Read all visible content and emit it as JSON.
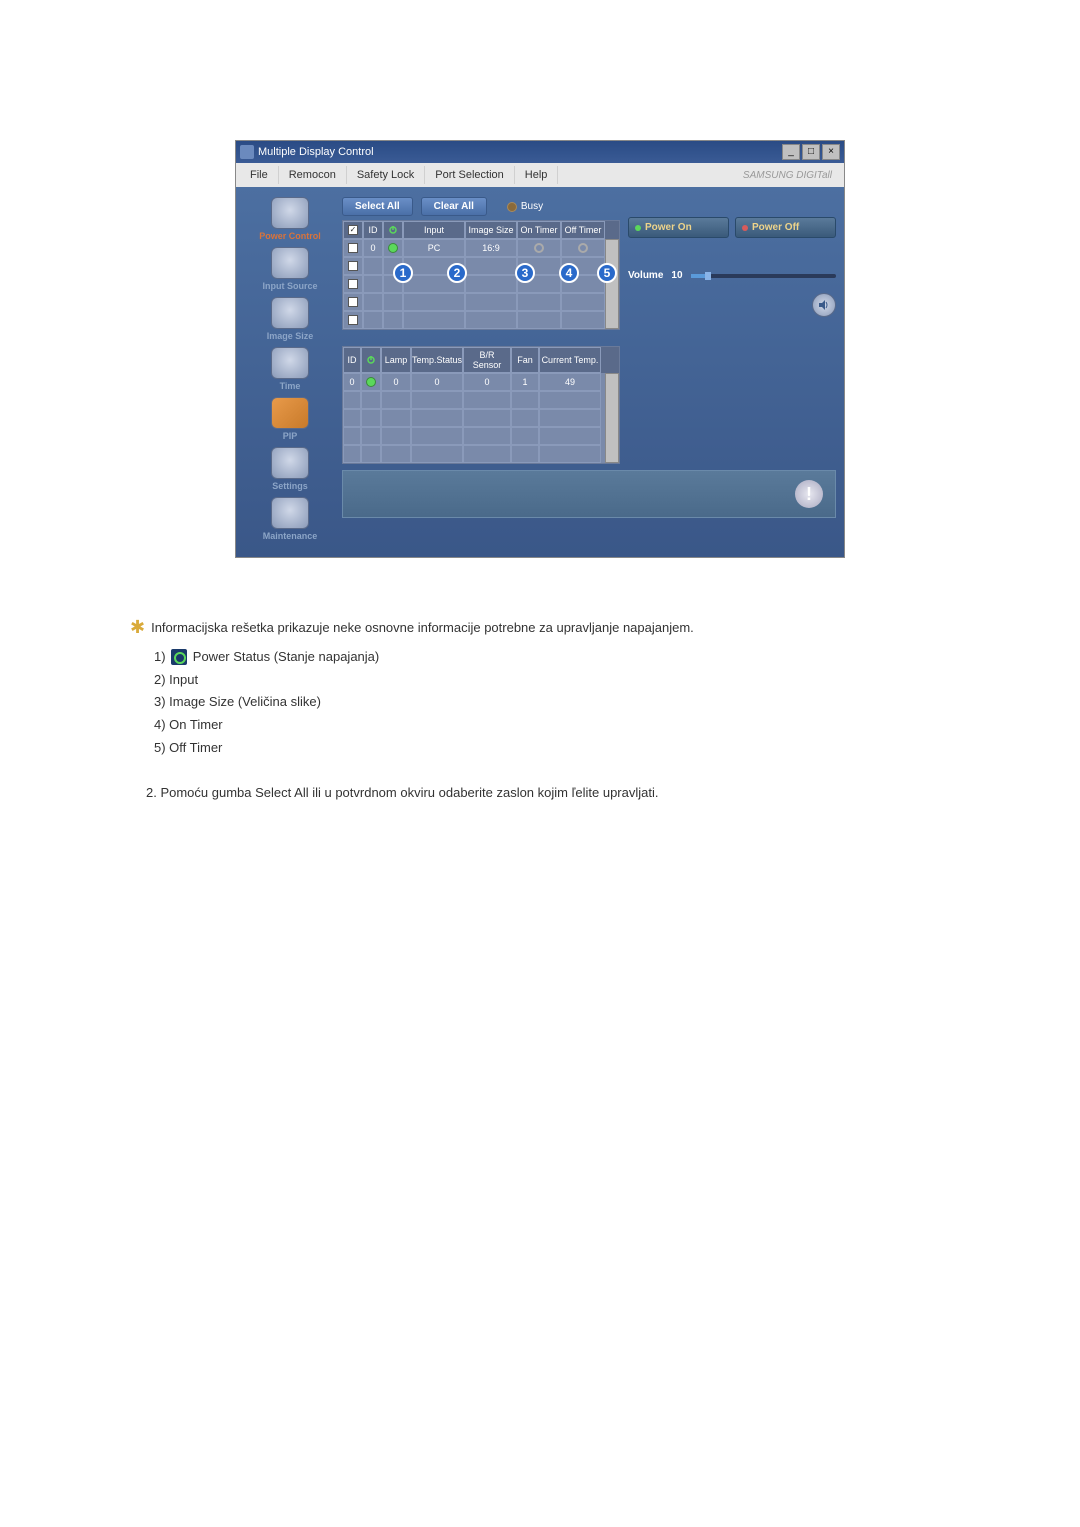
{
  "window": {
    "title": "Multiple Display Control"
  },
  "menu": {
    "file": "File",
    "remocon": "Remocon",
    "safety": "Safety Lock",
    "port": "Port Selection",
    "help": "Help",
    "brand": "SAMSUNG DIGITall"
  },
  "sidebar": {
    "power": "Power Control",
    "input": "Input Source",
    "image": "Image Size",
    "time": "Time",
    "pip": "PIP",
    "settings": "Settings",
    "maintenance": "Maintenance"
  },
  "buttons": {
    "select_all": "Select All",
    "clear_all": "Clear All",
    "busy": "Busy",
    "power_on": "Power On",
    "power_off": "Power Off"
  },
  "grid1": {
    "h_id": "ID",
    "h_input": "Input",
    "h_image": "Image Size",
    "h_on": "On Timer",
    "h_off": "Off Timer",
    "row": {
      "id": "0",
      "input": "PC",
      "image": "16:9"
    }
  },
  "grid2": {
    "h_id": "ID",
    "h_lamp": "Lamp",
    "h_temp": "Temp.Status",
    "h_br": "B/R Sensor",
    "h_fan": "Fan",
    "h_cur": "Current Temp.",
    "row": {
      "id": "0",
      "lamp": "0",
      "temp": "0",
      "br": "0",
      "fan": "1",
      "cur": "49"
    }
  },
  "volume": {
    "label": "Volume",
    "value": "10"
  },
  "callouts": {
    "n1": "1",
    "n2": "2",
    "n3": "3",
    "n4": "4",
    "n5": "5"
  },
  "doc": {
    "intro": "Informacijska rešetka prikazuje neke osnovne informacije potrebne za upravljanje napajanjem.",
    "l1a": "1) ",
    "l1b": " Power Status (Stanje napajanja)",
    "l2": "2) Input",
    "l3": "3) Image Size (Veličina slike)",
    "l4": "4) On Timer",
    "l5": "5) Off Timer",
    "p2": "2.  Pomoću gumba Select All ili u potvrdnom okviru odaberite zaslon kojim ľelite upravljati."
  }
}
